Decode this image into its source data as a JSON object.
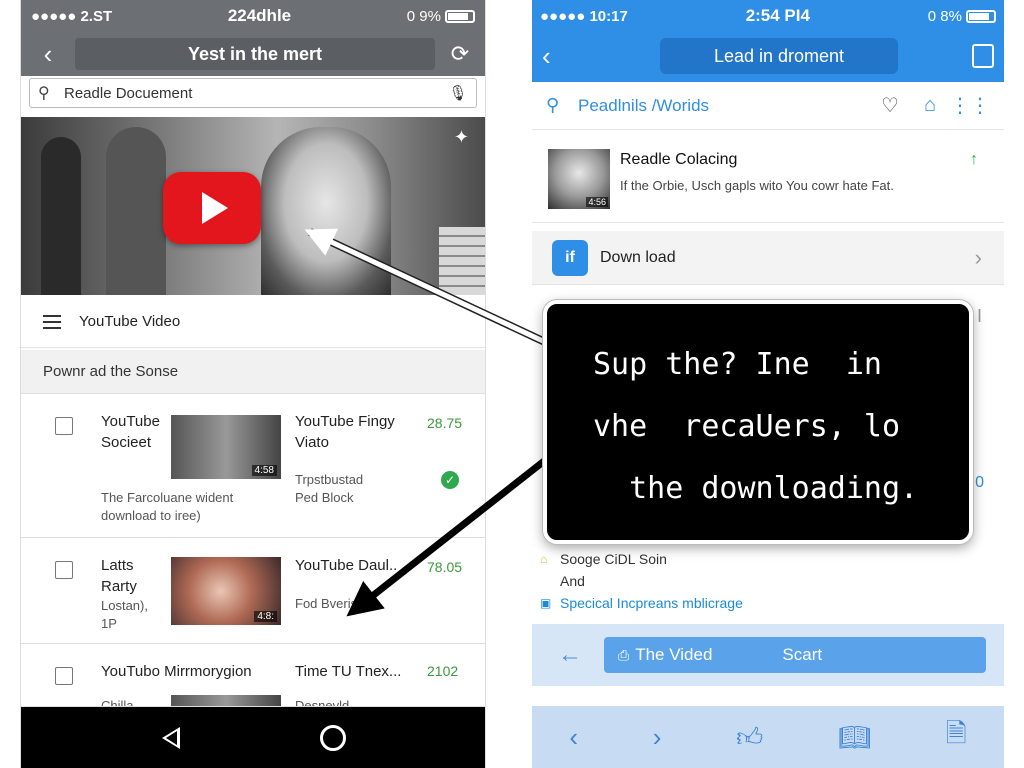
{
  "left": {
    "status": {
      "carrier": "●●●●● 2.ST",
      "time": "224dhle",
      "battery": "0 9%"
    },
    "nav": {
      "title": "Yest in the mert"
    },
    "search": {
      "value": "Readle Docuement"
    },
    "section_title": "YouTube Video",
    "subheader": "Pownr ad the Sonse",
    "rows": [
      {
        "title_lines": [
          "YouTube",
          "Socieet"
        ],
        "desc_lines": [
          "The Farcoluane wident",
          "download to iree)"
        ],
        "thumb_badge": "4:58",
        "right_title_lines": [
          "YouTube Fingy",
          "Viato"
        ],
        "right_desc_lines": [
          "Trpstbustad",
          "Ped Block"
        ],
        "number": "28.75"
      },
      {
        "title_lines": [
          "Latts",
          "Rarty"
        ],
        "desc_lines": [
          "Lostan),",
          "1P"
        ],
        "thumb_badge": "4:8:",
        "right_title_lines": [
          "YouTube Daul.."
        ],
        "right_desc_lines": [
          "Fod Bveris"
        ],
        "number": "78.05"
      },
      {
        "title_lines": [
          "YouTubo Mirrmorygion"
        ],
        "desc_lines": [
          "Chilla"
        ],
        "right_title_lines": [
          "Time TU Tnex..."
        ],
        "right_desc_lines": [
          "Desnevld"
        ],
        "number": "2102"
      }
    ]
  },
  "right": {
    "status": {
      "carrier": "●●●●● 10:17",
      "time": "2:54 PI4",
      "battery": "0 8%"
    },
    "nav": {
      "title": "Lead in droment"
    },
    "search": {
      "value": "Peadlnils /Worids"
    },
    "item": {
      "title": "Readle Colacing",
      "desc": "If the Orbie, Usch gapls wito You cowr hate Fat.",
      "thumb_badge": "4:56"
    },
    "download": {
      "icon_text": "if",
      "label": "Down load"
    },
    "list": [
      {
        "text": "Sooge CiDL Soin"
      },
      {
        "text": "And"
      },
      {
        "text": "Specical Incpreans mblicrage"
      }
    ],
    "action": {
      "button_label": "The Vided",
      "button_action": "Scart"
    },
    "hidden_marks": [
      "I",
      "0"
    ]
  },
  "popup": {
    "lines": [
      "Sup the? Ine  in",
      "vhe  recaUers, lo",
      "  the downloading."
    ]
  },
  "colors": {
    "left_bar": "#6c6f73",
    "right_bar": "#2f8ee5",
    "youtube_red": "#e4161d",
    "green": "#3a9a3a"
  }
}
